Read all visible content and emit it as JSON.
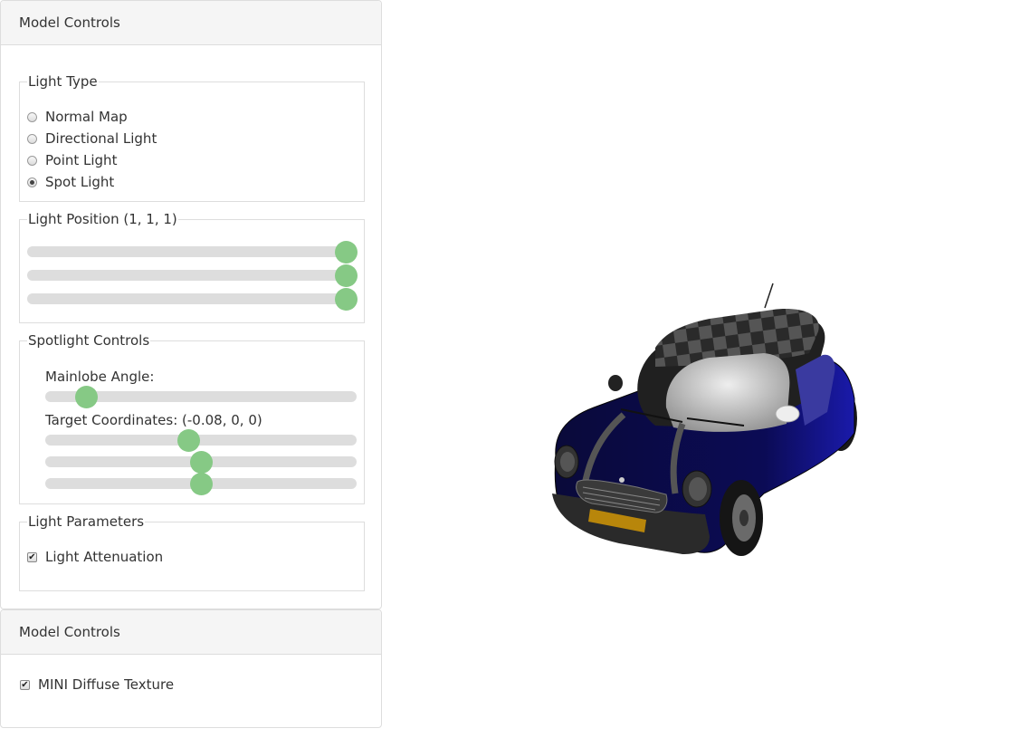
{
  "panel1": {
    "title": "Model Controls",
    "light_type": {
      "legend": "Light Type",
      "options": [
        {
          "label": "Normal Map",
          "checked": false
        },
        {
          "label": "Directional Light",
          "checked": false
        },
        {
          "label": "Point Light",
          "checked": false
        },
        {
          "label": "Spot Light",
          "checked": true
        }
      ]
    },
    "light_position": {
      "legend": "Light Position (1, 1, 1)",
      "sliders": [
        {
          "name": "x",
          "value": 1,
          "fraction": 1.0
        },
        {
          "name": "y",
          "value": 1,
          "fraction": 1.0
        },
        {
          "name": "z",
          "value": 1,
          "fraction": 1.0
        }
      ]
    },
    "spotlight": {
      "legend": "Spotlight Controls",
      "mainlobe_label": "Mainlobe Angle:",
      "mainlobe_fraction": 0.13,
      "target_label": "Target Coordinates: (-0.08, 0, 0)",
      "target_sliders": [
        {
          "name": "x",
          "value": -0.08,
          "fraction": 0.46
        },
        {
          "name": "y",
          "value": 0,
          "fraction": 0.5
        },
        {
          "name": "z",
          "value": 0,
          "fraction": 0.5
        }
      ]
    },
    "light_params": {
      "legend": "Light Parameters",
      "attenuation_label": "Light Attenuation",
      "attenuation_checked": true
    }
  },
  "panel2": {
    "title": "Model Controls",
    "diffuse_label": "MINI Diffuse Texture",
    "diffuse_checked": true
  },
  "colors": {
    "thumb": "#86c985",
    "track": "#dddddd",
    "header_bg": "#f5f5f5",
    "car_body": "#0a0a4a"
  },
  "viewport": {
    "model": "mini-cooper-car"
  }
}
